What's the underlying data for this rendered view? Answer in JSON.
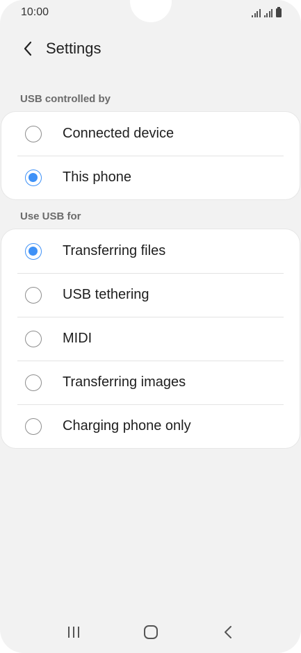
{
  "status_bar": {
    "time": "10:00",
    "icons": [
      "signal-icon",
      "signal-icon",
      "battery-icon"
    ]
  },
  "header": {
    "back_icon": "chevron-left-icon",
    "title": "Settings"
  },
  "usb_controlled_by": {
    "label": "USB controlled by",
    "options": [
      {
        "label": "Connected device",
        "selected": false
      },
      {
        "label": "This phone",
        "selected": true
      }
    ]
  },
  "use_usb_for": {
    "label": "Use USB for",
    "options": [
      {
        "label": "Transferring files",
        "selected": true
      },
      {
        "label": "USB tethering",
        "selected": false
      },
      {
        "label": "MIDI",
        "selected": false
      },
      {
        "label": "Transferring images",
        "selected": false
      },
      {
        "label": "Charging phone only",
        "selected": false
      }
    ]
  },
  "nav_bar": {
    "icons": [
      "recent-apps-icon",
      "home-icon",
      "back-icon"
    ]
  },
  "colors": {
    "accent": "#3e91f7",
    "background": "#f2f2f2",
    "card": "#ffffff"
  }
}
